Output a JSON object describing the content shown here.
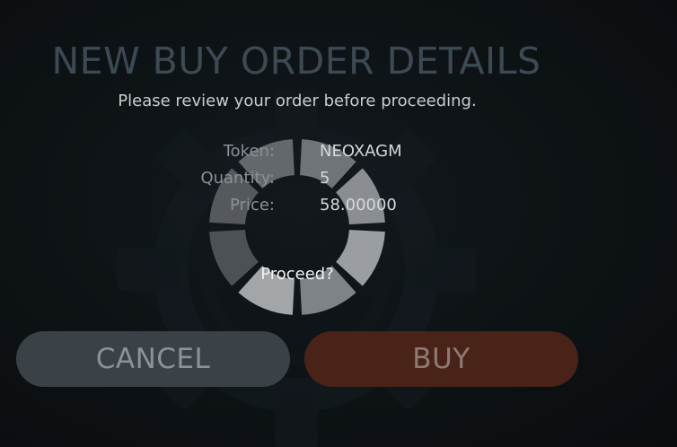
{
  "dialog": {
    "title": "NEW BUY ORDER DETAILS",
    "subtitle": "Please review your order before proceeding."
  },
  "order": {
    "token_label": "Token:",
    "token_value": "NEOXAGM",
    "quantity_label": "Quantity:",
    "quantity_value": "5",
    "price_label": "Price:",
    "price_value": "58.00000"
  },
  "prompt": "Proceed?",
  "buttons": {
    "cancel_label": "CANCEL",
    "buy_label": "BUY"
  },
  "icons": {
    "background": "gear-icon",
    "loading": "loading-spinner-icon"
  },
  "colors": {
    "background": "#0c1013",
    "cancel_button": "#3a4247",
    "buy_button": "#4a2318"
  }
}
